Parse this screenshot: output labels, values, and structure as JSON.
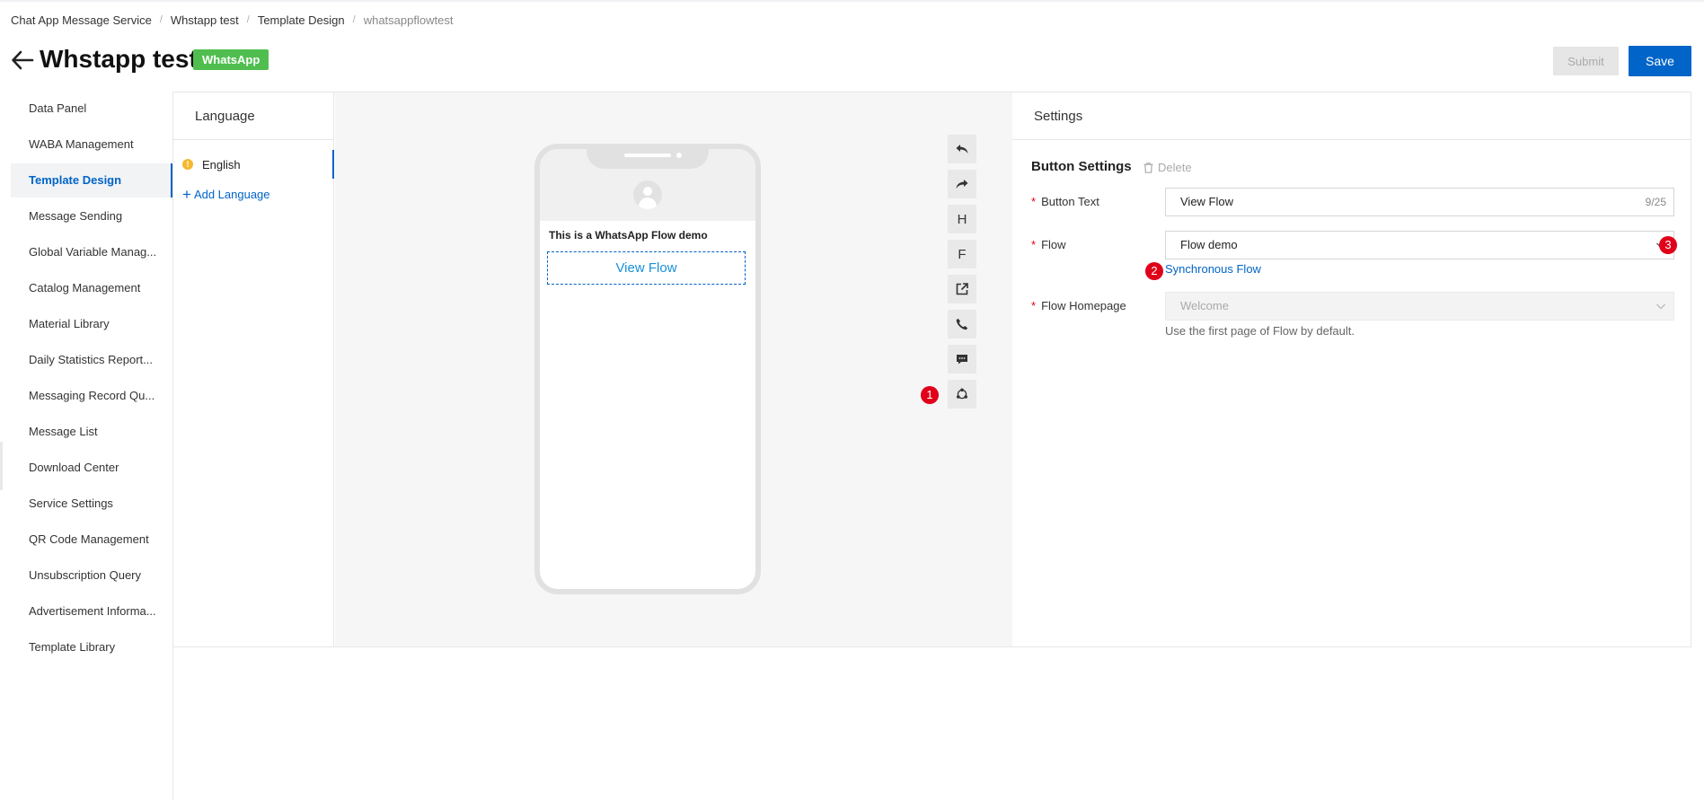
{
  "breadcrumb": {
    "items": [
      "Chat App Message Service",
      "Whstapp test",
      "Template Design"
    ],
    "current": "whatsappflowtest",
    "separator": "/"
  },
  "header": {
    "title": "Whstapp test",
    "badge": "WhatsApp",
    "submit_label": "Submit",
    "save_label": "Save"
  },
  "sidebar": {
    "items": [
      {
        "label": "Data Panel"
      },
      {
        "label": "WABA Management"
      },
      {
        "label": "Template Design"
      },
      {
        "label": "Message Sending"
      },
      {
        "label": "Global Variable Manag..."
      },
      {
        "label": "Catalog Management"
      },
      {
        "label": "Material Library"
      },
      {
        "label": "Daily Statistics Report..."
      },
      {
        "label": "Messaging Record Qu..."
      },
      {
        "label": "Message List"
      },
      {
        "label": "Download Center"
      },
      {
        "label": "Service Settings"
      },
      {
        "label": "QR Code Management"
      },
      {
        "label": "Unsubscription Query"
      },
      {
        "label": "Advertisement Informa..."
      },
      {
        "label": "Template Library"
      }
    ],
    "active": "Template Design"
  },
  "language": {
    "title": "Language",
    "items": [
      {
        "label": "English",
        "status_icon": "warning-icon"
      }
    ],
    "add_label": "Add Language"
  },
  "preview": {
    "message_text": "This is a WhatsApp Flow demo",
    "flow_button": "View Flow"
  },
  "toolbar": {
    "tools": [
      {
        "name": "undo",
        "icon": "reply-icon"
      },
      {
        "name": "redo",
        "icon": "forward-icon"
      },
      {
        "name": "header",
        "label": "H"
      },
      {
        "name": "footer",
        "label": "F"
      },
      {
        "name": "url-button",
        "icon": "external-link-icon"
      },
      {
        "name": "phone-button",
        "icon": "phone-icon"
      },
      {
        "name": "quick-reply",
        "icon": "chat-icon"
      },
      {
        "name": "flow-button",
        "icon": "flow-icon"
      }
    ]
  },
  "markers": {
    "m1": "1",
    "m2": "2",
    "m3": "3"
  },
  "settings": {
    "title": "Settings",
    "section_title": "Button Settings",
    "delete_label": "Delete",
    "required_mark": "*",
    "button_text": {
      "label": "Button Text",
      "value": "View Flow",
      "counter": "9/25"
    },
    "flow": {
      "label": "Flow",
      "value": "Flow demo"
    },
    "sync_link": "Synchronous Flow",
    "flow_homepage": {
      "label": "Flow Homepage",
      "placeholder": "Welcome",
      "help": "Use the first page of Flow by default."
    }
  },
  "colors": {
    "accent": "#0064c8",
    "badge": "#4fbe4f",
    "marker": "#e0001a",
    "warning": "#f5b82e"
  }
}
